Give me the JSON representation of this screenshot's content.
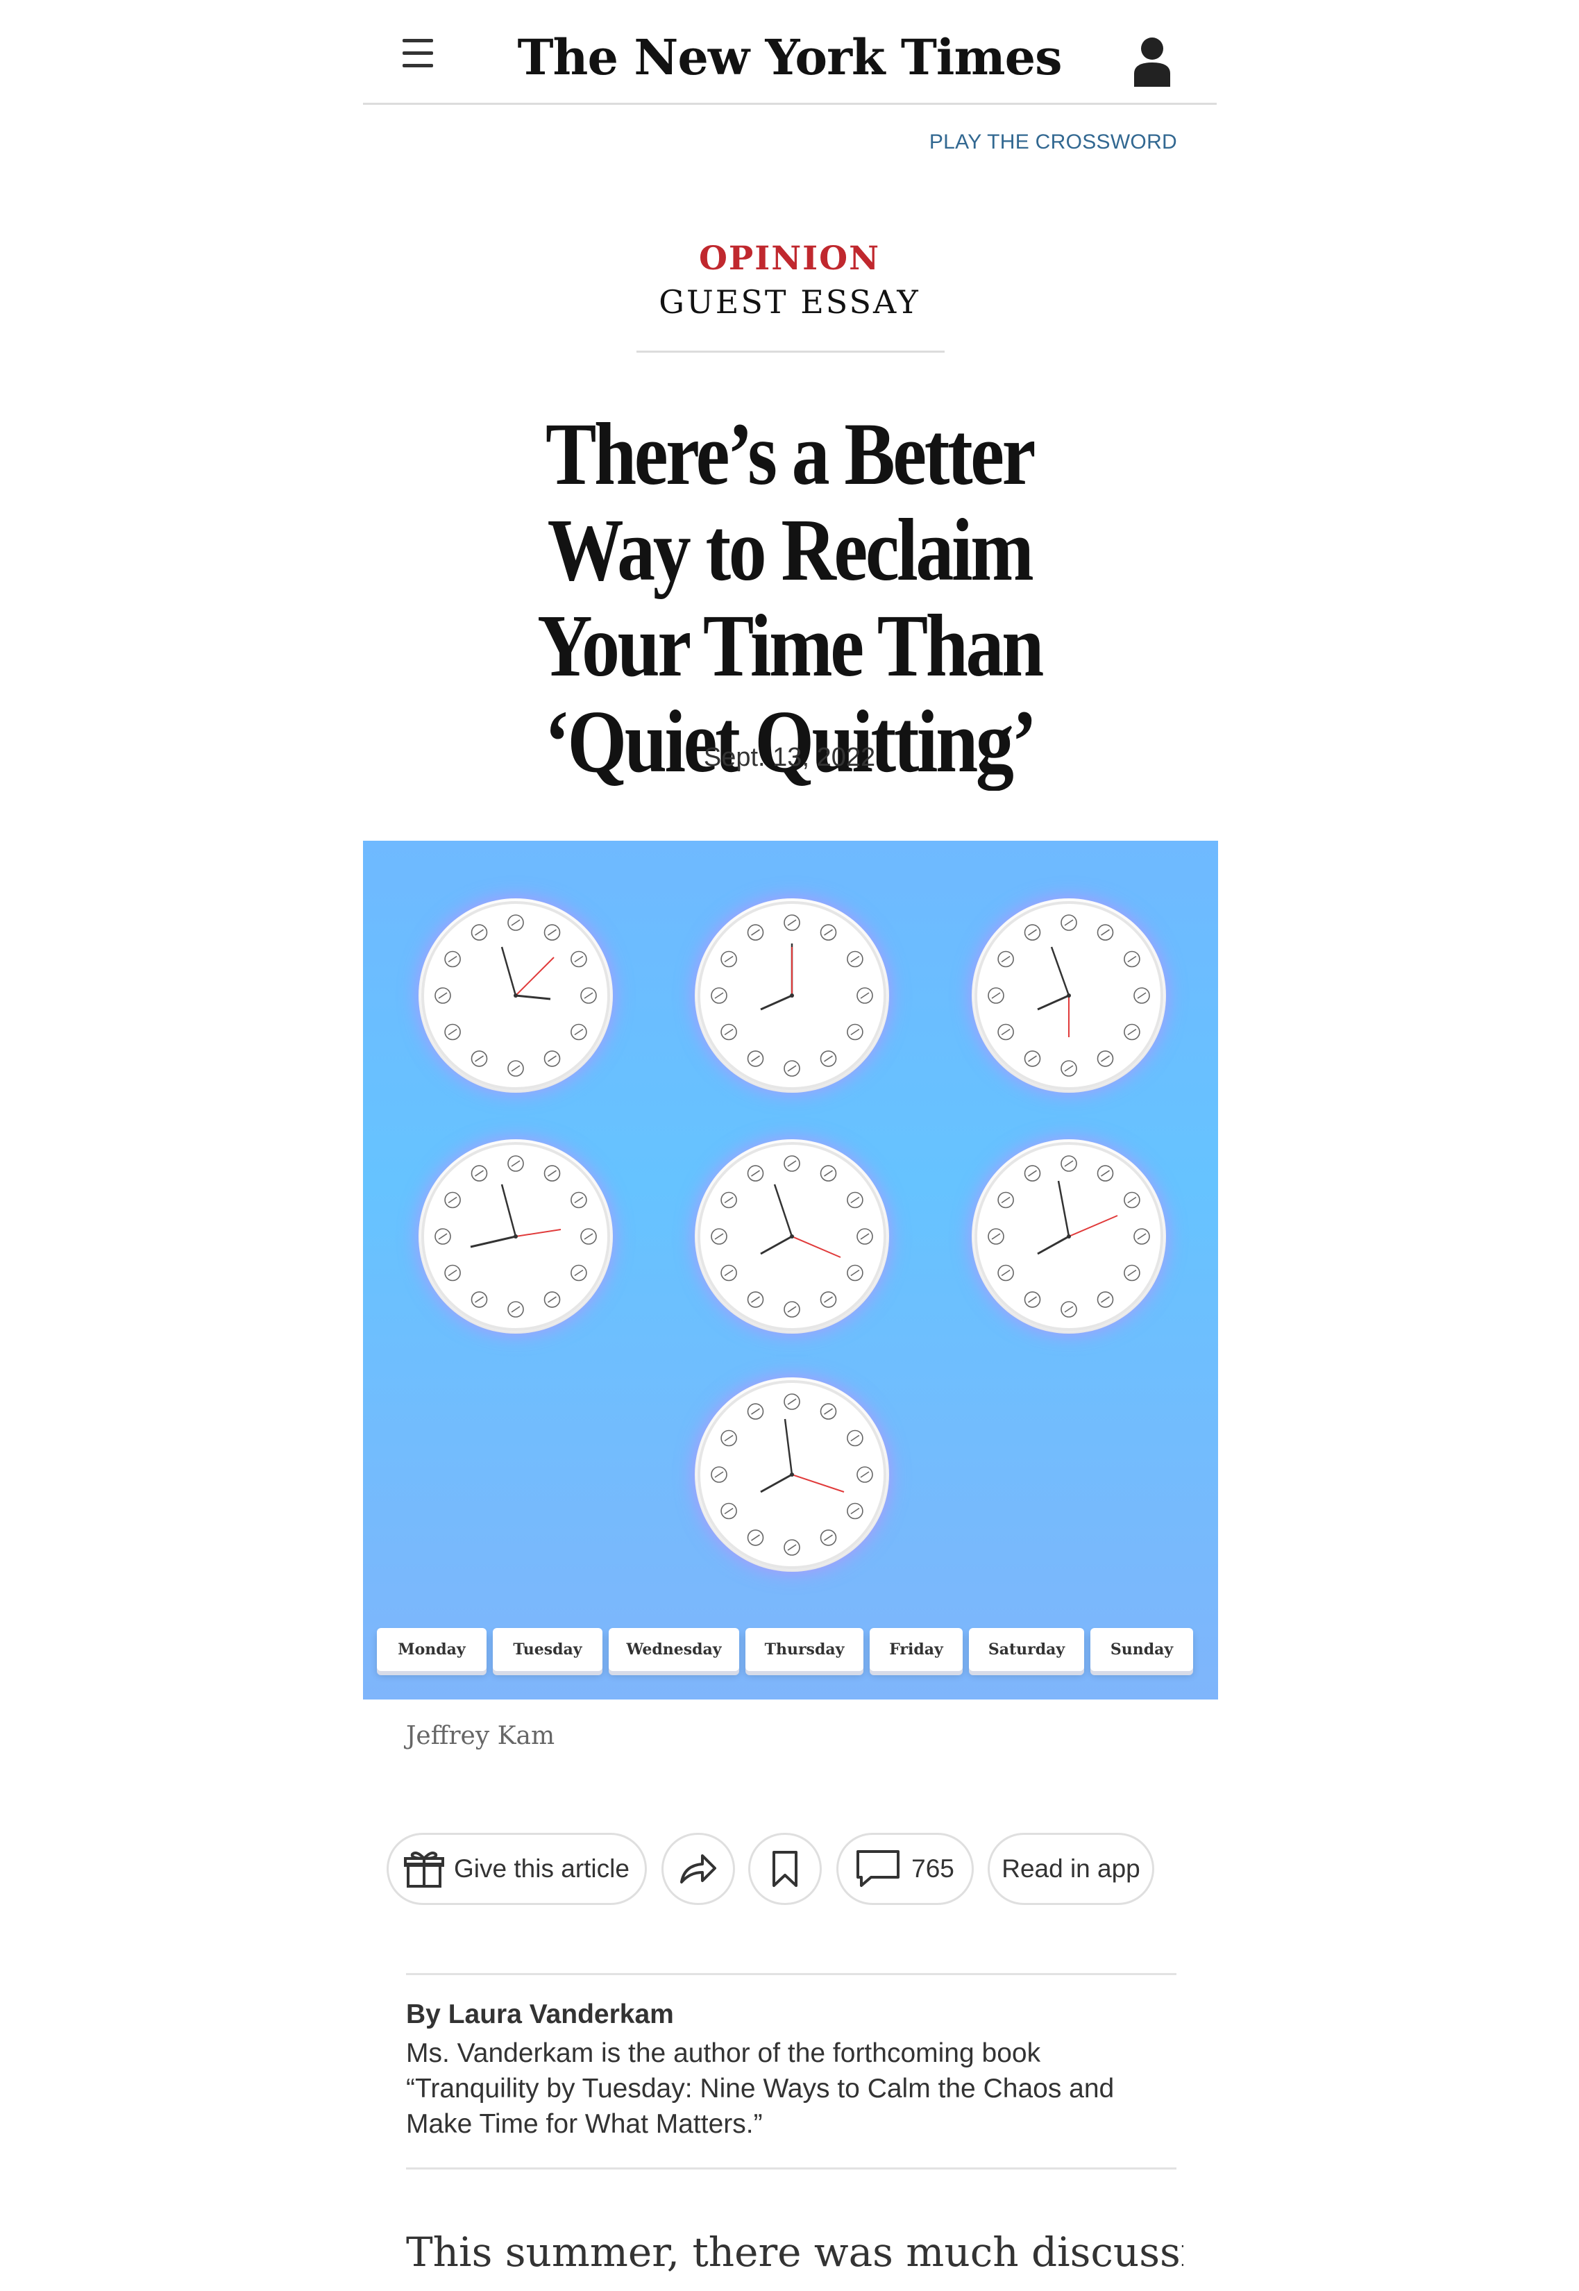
{
  "header": {
    "masthead": "The New York Times",
    "menu_icon": "hamburger-menu-icon",
    "account_icon": "user-account-icon",
    "crossword_link": "PLAY THE CROSSWORD"
  },
  "article": {
    "section": "OPINION",
    "kicker": "GUEST ESSAY",
    "headline": "There’s a Better Way to Reclaim Your Time Than ‘Quiet Quitting’",
    "date": "Sept. 13, 2022"
  },
  "illustration": {
    "background_color": "#6fbaff",
    "days": [
      "Monday",
      "Tuesday",
      "Wednesday",
      "Thursday",
      "Friday",
      "Saturday",
      "Sunday"
    ],
    "credit": "Jeffrey Kam"
  },
  "actions": {
    "give_label": "Give this article",
    "gift_icon": "gift-icon",
    "share_icon": "share-icon",
    "save_icon": "bookmark-icon",
    "comment_icon": "comment-icon",
    "comment_count": "765",
    "read_in_app": "Read in app"
  },
  "author": {
    "byline": "By Laura Vanderkam",
    "bio": "Ms. Vanderkam is the author of the forthcoming book “Tranquility by Tuesday: Nine Ways to Calm the Chaos and Make Time for What Matters.”"
  },
  "body": {
    "first_line": "This summer, there was much discussion of"
  }
}
